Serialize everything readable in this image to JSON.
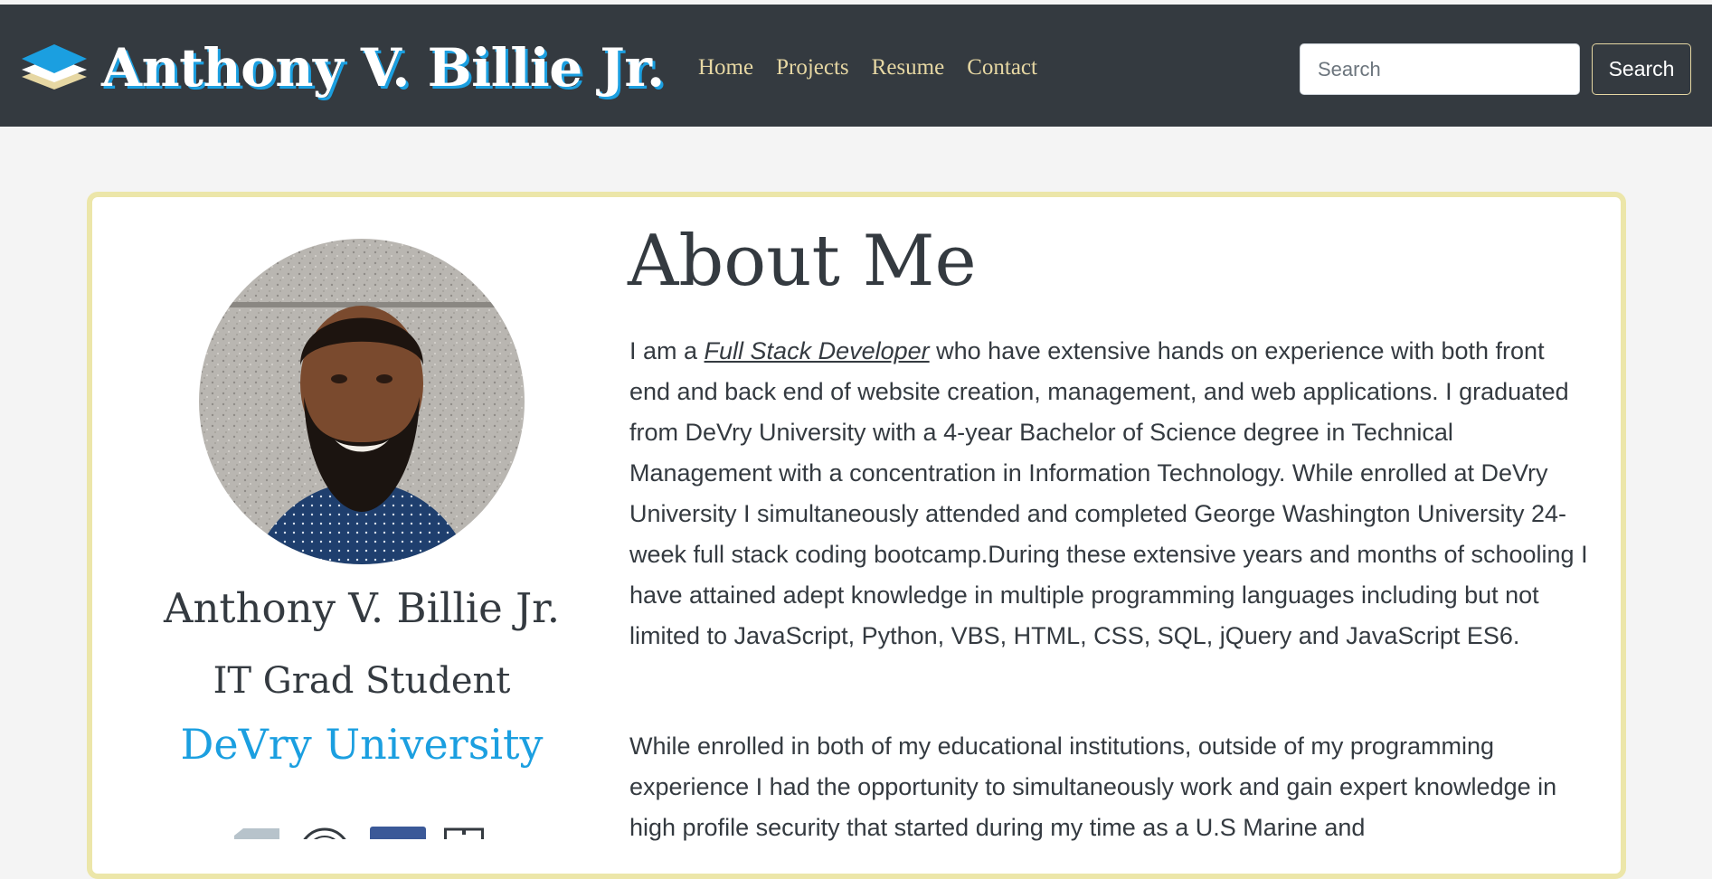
{
  "navbar": {
    "brand_name": "Anthony V. Billie Jr.",
    "brand_icon": "layers-icon",
    "links": [
      {
        "label": "Home"
      },
      {
        "label": "Projects"
      },
      {
        "label": "Resume"
      },
      {
        "label": "Contact"
      }
    ],
    "search": {
      "placeholder": "Search",
      "button_label": "Search"
    }
  },
  "profile": {
    "name": "Anthony V. Billie Jr.",
    "role": "IT Grad Student",
    "school": "DeVry University",
    "social_icons": [
      "linkedin-icon",
      "github-icon",
      "facebook-icon",
      "resume-icon"
    ]
  },
  "about": {
    "title": "About Me",
    "p1_prefix": "I am a ",
    "p1_role_link": "Full Stack Developer",
    "p1_rest": " who have extensive hands on experience with both front end and back end of website creation, management, and web applications. I graduated from DeVry University with a 4-year Bachelor of Science degree in Technical Management with a concentration in Information Technology. While enrolled at DeVry University I simultaneously attended and completed George Washington University 24-week full stack coding bootcamp.During these extensive years and months of schooling I have attained adept knowledge in multiple programming languages including but not limited to JavaScript, Python, VBS, HTML, CSS, SQL, jQuery and JavaScript ES6.",
    "p2": "While enrolled in both of my educational institutions, outside of my programming experience I had the opportunity to simultaneously work and gain expert knowledge in high profile security that started during my time as a U.S Marine and"
  },
  "colors": {
    "navbar_bg": "#343a40",
    "nav_link": "#e6d7a3",
    "brand_shadow": "#1b9fe0",
    "school_link": "#1b9fe0",
    "card_border": "#ece6a9"
  }
}
